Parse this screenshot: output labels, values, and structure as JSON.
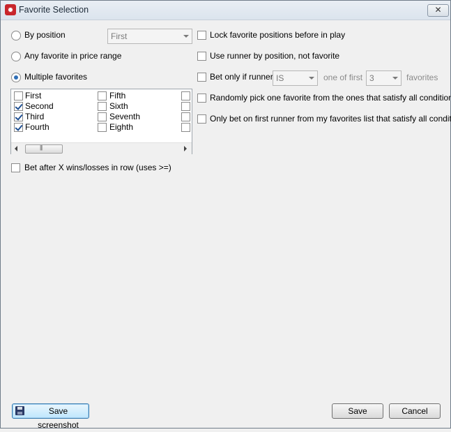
{
  "window": {
    "title": "Favorite Selection",
    "close_glyph": "✕"
  },
  "left": {
    "by_position": {
      "label": "By position",
      "checked": false,
      "combo_value": "First"
    },
    "price_range": {
      "label": "Any favorite in price range",
      "checked": false
    },
    "multiple": {
      "label": "Multiple favorites",
      "checked": true
    },
    "favorites_list": [
      {
        "label": "First",
        "checked": false
      },
      {
        "label": "Second",
        "checked": true
      },
      {
        "label": "Third",
        "checked": true
      },
      {
        "label": "Fourth",
        "checked": true
      },
      {
        "label": "Fifth",
        "checked": false
      },
      {
        "label": "Sixth",
        "checked": false
      },
      {
        "label": "Seventh",
        "checked": false
      },
      {
        "label": "Eighth",
        "checked": false
      }
    ],
    "bet_after": {
      "label": "Bet after X wins/losses in row (uses >=)",
      "checked": false
    }
  },
  "right": {
    "lock": {
      "label": "Lock favorite positions before in play",
      "checked": false
    },
    "use_runner": {
      "label": "Use runner by position, not favorite",
      "checked": false
    },
    "bet_only": {
      "label": "Bet only if runner",
      "checked": false,
      "combo1": "IS",
      "mid_text": "one of first",
      "combo2": "3",
      "tail_text": "favorites"
    },
    "random": {
      "label": "Randomly pick one favorite from the ones that satisfy all conditions",
      "checked": false
    },
    "only_first": {
      "label": "Only bet on first runner from my favorites list that satisfy all conditions",
      "checked": false
    }
  },
  "footer": {
    "save_screenshot": "Save screenshot",
    "save": "Save",
    "cancel": "Cancel"
  },
  "icons": {
    "app": "app-logo-icon",
    "floppy": "floppy-disk-icon",
    "scroll": "scroll-thumb-grip"
  }
}
